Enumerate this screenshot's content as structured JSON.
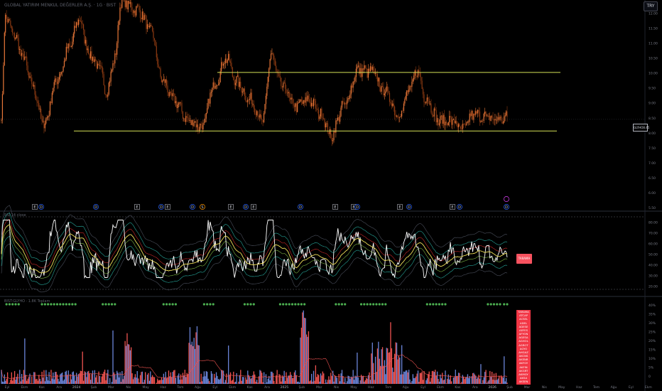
{
  "header": {
    "title": "GLOBAL YATIRIM MENKUL DEĞERLER A.Ş. · 1G · BIST",
    "currency": "TRY"
  },
  "colors": {
    "up": "#e87738",
    "down": "#8c3a12",
    "channel": "#d4e157",
    "rsi": "#ffffff",
    "rsi_ma": "#f1e05a",
    "vol_red": "#ef5350",
    "vol_blue": "#6a84d8",
    "signal": "#4caf50",
    "tag": "#f23645"
  },
  "indicator_labels": {
    "rsi": "RSI 14 close",
    "volume": "BIST:GLYHO · 1.8K Toplam"
  },
  "chart_data": [
    {
      "type": "candlestick",
      "price_axis": [
        "12.00",
        "11.50",
        "11.00",
        "10.50",
        "10.00",
        "9.50",
        "9.00",
        "8.50",
        "8.00",
        "7.50",
        "7.00",
        "6.50",
        "6.00",
        "5.50"
      ],
      "ylim": [
        5.5,
        12.25
      ],
      "last_price": {
        "label": "GLYHO",
        "value": "8.45"
      },
      "channel": {
        "upper": 10.02,
        "lower": 8.06
      },
      "time_axis": [
        "Eyl",
        "Ekm",
        "Kas",
        "Ara",
        "2024",
        "Şub",
        "Mar",
        "Nis",
        "May",
        "Haz",
        "Tem",
        "Ağu",
        "Eyl",
        "Ekm",
        "Kas",
        "Ara",
        "2025",
        "Şub",
        "Mar",
        "Nis",
        "May",
        "Haz",
        "Tem",
        "Ağu",
        "Eyl",
        "Ekm",
        "Kas",
        "Ara",
        "2026",
        "Şub",
        "Mar",
        "Nis",
        "May",
        "Haz",
        "Tem",
        "Ağu",
        "Eyl",
        "Ekm",
        "Kas",
        "Ara",
        "Oca"
      ],
      "events": [
        "E",
        "D",
        "D",
        "E",
        "D",
        "E",
        "D",
        "S",
        "E",
        "D",
        "E",
        "D",
        "E",
        "E",
        "D",
        "E",
        "D",
        "E",
        "D",
        "D"
      ]
    },
    {
      "type": "line",
      "name": "RSI",
      "axis": [
        "80.00",
        "70.00",
        "60.00",
        "50.00",
        "40.00",
        "30.00",
        "20.00"
      ],
      "ylim": [
        15,
        85
      ],
      "status_label": "TARAMA"
    },
    {
      "type": "bar",
      "name": "Volume",
      "axis": [
        "40%",
        "35%",
        "30%",
        "25%",
        "20%",
        "15%",
        "10%",
        "5%",
        "0"
      ],
      "screen_list": [
        "TARAMA",
        "ATCAP",
        "ACSEL",
        "ADEL",
        "ADESE",
        "AEFES",
        "AFYON",
        "AGESA",
        "AGHOL",
        "AGROT",
        "AGYO",
        "AHGAZ",
        "AKCNS",
        "AKENR",
        "AKFGY",
        "AKFIN",
        "AKGRT",
        "AKMGY",
        "AKSA",
        "AKSEN"
      ]
    }
  ]
}
